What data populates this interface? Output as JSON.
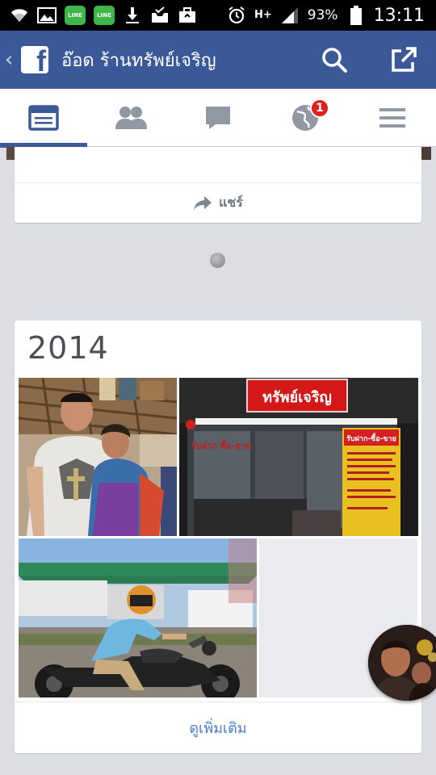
{
  "status_bar": {
    "battery_percent": "93%",
    "time": "13:11",
    "network": "H+",
    "icons": [
      "wifi-icon",
      "gallery-icon",
      "line-app-icon",
      "line-app-icon",
      "download-icon",
      "inbox-check-icon",
      "briefcase-icon",
      "alarm-icon",
      "signal-icon",
      "battery-icon"
    ],
    "line_label": "LINE"
  },
  "header": {
    "title": "อ๊อด ร้านทรัพย์เจริญ",
    "color": "#3b5998"
  },
  "tabs": [
    {
      "name": "news-feed",
      "icon": "news-feed-icon",
      "active": true
    },
    {
      "name": "friend-requests",
      "icon": "friends-icon",
      "active": false
    },
    {
      "name": "messages",
      "icon": "chat-icon",
      "active": false
    },
    {
      "name": "notifications",
      "icon": "globe-icon",
      "active": false,
      "badge": "1"
    },
    {
      "name": "more",
      "icon": "menu-icon",
      "active": false
    }
  ],
  "share": {
    "label": "แชร์"
  },
  "year_section": {
    "year": "2014",
    "see_more": "ดูเพิ่มเติม",
    "shop_sign": "ทรัพย์เจริญ",
    "shop_window_text": "รับฝาก ซื้อ-ขาย",
    "shop_board_title": "รับฝาก-ซื้อ-ขาย"
  }
}
